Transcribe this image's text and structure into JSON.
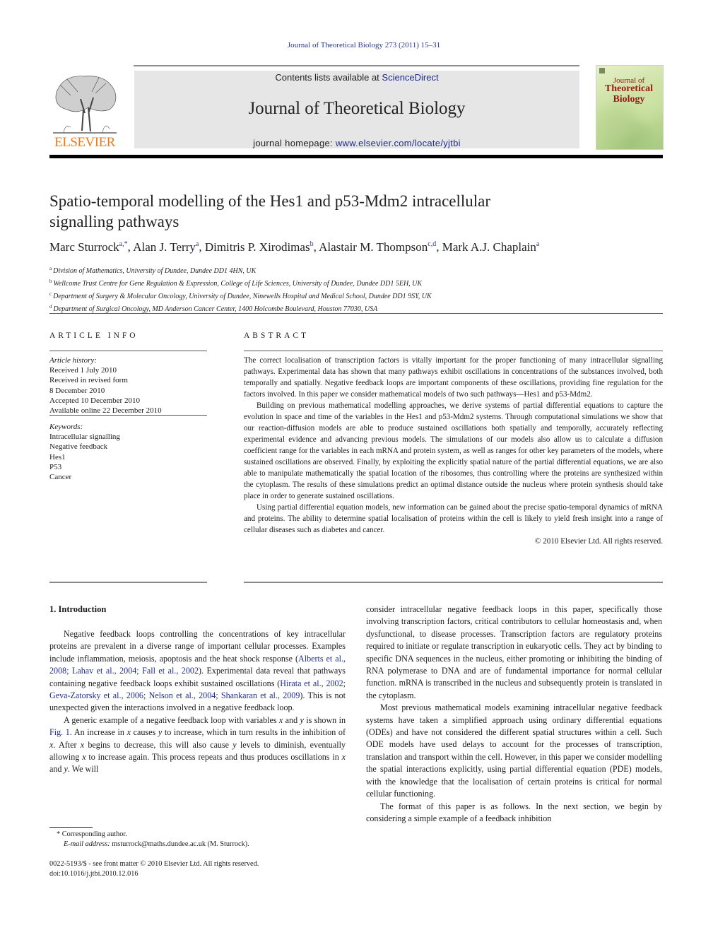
{
  "running_head": "Journal of Theoretical Biology 273 (2011) 15–31",
  "header": {
    "publisher_logo_text": "ELSEVIER",
    "contents_prefix": "Contents lists available at ",
    "contents_link": "ScienceDirect",
    "journal_name": "Journal of Theoretical Biology",
    "homepage_prefix": "journal homepage: ",
    "homepage_link": "www.elsevier.com/locate/yjtbi",
    "cover": {
      "line1": "Journal of",
      "line2": "Theoretical",
      "line3": "Biology"
    }
  },
  "article": {
    "title_line1": "Spatio-temporal modelling of the Hes1 and p53-Mdm2 intracellular",
    "title_line2": "signalling pathways",
    "authors": [
      {
        "name": "Marc Sturrock",
        "sup": "a,*",
        "sep": ", "
      },
      {
        "name": "Alan J. Terry",
        "sup": "a",
        "sep": ", "
      },
      {
        "name": "Dimitris P. Xirodimas",
        "sup": "b",
        "sep": ", "
      },
      {
        "name": "Alastair M. Thompson",
        "sup": "c,d",
        "sep": ", "
      },
      {
        "name": "Mark A.J. Chaplain",
        "sup": "a",
        "sep": ""
      }
    ],
    "affiliations": [
      {
        "key": "a",
        "text": "Division of Mathematics, University of Dundee, Dundee DD1 4HN, UK"
      },
      {
        "key": "b",
        "text": "Wellcome Trust Centre for Gene Regulation & Expression, College of Life Sciences, University of Dundee, Dundee DD1 5EH, UK"
      },
      {
        "key": "c",
        "text": "Department of Surgery & Molecular Oncology, University of Dundee, Ninewells Hospital and Medical School, Dundee DD1 9SY, UK"
      },
      {
        "key": "d",
        "text": "Department of Surgical Oncology, MD Anderson Cancer Center, 1400 Holcombe Boulevard, Houston 77030, USA"
      }
    ]
  },
  "article_info": {
    "heading": "ARTICLE INFO",
    "history_label": "Article history:",
    "history": [
      "Received 1 July 2010",
      "Received in revised form",
      "8 December 2010",
      "Accepted 10 December 2010",
      "Available online 22 December 2010"
    ],
    "keywords_label": "Keywords:",
    "keywords": [
      "Intracellular signalling",
      "Negative feedback",
      "Hes1",
      "P53",
      "Cancer"
    ]
  },
  "abstract": {
    "heading": "ABSTRACT",
    "paragraphs": [
      "The correct localisation of transcription factors is vitally important for the proper functioning of many intracellular signalling pathways. Experimental data has shown that many pathways exhibit oscillations in concentrations of the substances involved, both temporally and spatially. Negative feedback loops are important components of these oscillations, providing fine regulation for the factors involved. In this paper we consider mathematical models of two such pathways—Hes1 and p53-Mdm2.",
      "Building on previous mathematical modelling approaches, we derive systems of partial differential equations to capture the evolution in space and time of the variables in the Hes1 and p53-Mdm2 systems. Through computational simulations we show that our reaction-diffusion models are able to produce sustained oscillations both spatially and temporally, accurately reflecting experimental evidence and advancing previous models. The simulations of our models also allow us to calculate a diffusion coefficient range for the variables in each mRNA and protein system, as well as ranges for other key parameters of the models, where sustained oscillations are observed. Finally, by exploiting the explicitly spatial nature of the partial differential equations, we are also able to manipulate mathematically the spatial location of the ribosomes, thus controlling where the proteins are synthesized within the cytoplasm. The results of these simulations predict an optimal distance outside the nucleus where protein synthesis should take place in order to generate sustained oscillations.",
      "Using partial differential equation models, new information can be gained about the precise spatio-temporal dynamics of mRNA and proteins. The ability to determine spatial localisation of proteins within the cell is likely to yield fresh insight into a range of cellular diseases such as diabetes and cancer."
    ],
    "copyright": "© 2010 Elsevier Ltd. All rights reserved."
  },
  "introduction": {
    "heading": "1.   Introduction",
    "p1": [
      {
        "t": "Negative feedback loops controlling the concentrations of key intracellular proteins are prevalent in a diverse range of important cellular processes. Examples include inflammation, meiosis, apoptosis and the heat shock response ("
      },
      {
        "t": "Alberts et al., 2008; Lahav et al., 2004; Fall et al., 2002",
        "link": true
      },
      {
        "t": "). Experimental data reveal that pathways containing negative feedback loops exhibit sustained oscillations ("
      },
      {
        "t": "Hirata et al., 2002; Geva-Zatorsky et al., 2006; Nelson et al., 2004; Shankaran et al., 2009",
        "link": true
      },
      {
        "t": "). This is not unexpected given the interactions involved in a negative feedback loop."
      }
    ],
    "p2": [
      {
        "t": "A generic example of a negative feedback loop with variables "
      },
      {
        "t": "x",
        "i": true
      },
      {
        "t": " and "
      },
      {
        "t": "y",
        "i": true
      },
      {
        "t": " is shown in "
      },
      {
        "t": "Fig. 1",
        "link": true
      },
      {
        "t": ". An increase in "
      },
      {
        "t": "x",
        "i": true
      },
      {
        "t": " causes "
      },
      {
        "t": "y",
        "i": true
      },
      {
        "t": " to increase, which in turn results in the inhibition of "
      },
      {
        "t": "x",
        "i": true
      },
      {
        "t": ". After "
      },
      {
        "t": "x",
        "i": true
      },
      {
        "t": " begins to decrease, this will also cause "
      },
      {
        "t": "y",
        "i": true
      },
      {
        "t": " levels to diminish, eventually allowing "
      },
      {
        "t": "x",
        "i": true
      },
      {
        "t": " to increase again. This process repeats and thus produces oscillations in "
      },
      {
        "t": "x",
        "i": true
      },
      {
        "t": " and "
      },
      {
        "t": "y",
        "i": true
      },
      {
        "t": ". We will"
      }
    ],
    "right_p1": "consider intracellular negative feedback loops in this paper, specifically those involving transcription factors, critical contributors to cellular homeostasis and, when dysfunctional, to disease processes. Transcription factors are regulatory proteins required to initiate or regulate transcription in eukaryotic cells. They act by binding to specific DNA sequences in the nucleus, either promoting or inhibiting the binding of RNA polymerase to DNA and are of fundamental importance for normal cellular function. mRNA is transcribed in the nucleus and subsequently protein is translated in the cytoplasm.",
    "right_p2": "Most previous mathematical models examining intracellular negative feedback systems have taken a simplified approach using ordinary differential equations (ODEs) and have not considered the different spatial structures within a cell. Such ODE models have used delays to account for the processes of transcription, translation and transport within the cell. However, in this paper we consider modelling the spatial interactions explicitly, using partial differential equation (PDE) models, with the knowledge that the localisation of certain proteins is critical for normal cellular functioning.",
    "right_p3": "The format of this paper is as follows. In the next section, we begin by considering a simple example of a feedback inhibition"
  },
  "footnotes": {
    "corresponding": "* Corresponding author.",
    "email_label": "E-mail address:",
    "email": " msturrock@maths.dundee.ac.uk (M. Sturrock).",
    "front_matter": "0022-5193/$ - see front matter © 2010 Elsevier Ltd. All rights reserved.",
    "doi": "doi:10.1016/j.jtbi.2010.12.016"
  }
}
